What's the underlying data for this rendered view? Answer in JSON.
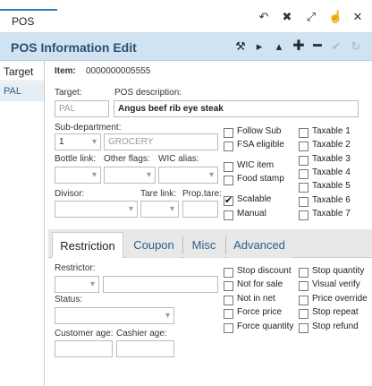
{
  "window": {
    "tab_label": "POS",
    "icons": [
      "undo-icon",
      "shrink-icon",
      "expand-icon",
      "pointer-icon",
      "close-icon"
    ]
  },
  "header": {
    "title": "POS Information Edit",
    "icons": [
      "pin-icon",
      "next-icon",
      "collapse-icon",
      "add-icon",
      "remove-icon",
      "save-icon",
      "revert-icon"
    ]
  },
  "leftnav": {
    "items": [
      {
        "label": "Target"
      },
      {
        "label": "PAL"
      }
    ]
  },
  "item": {
    "label": "Item:",
    "value": "0000000005555"
  },
  "target": {
    "label": "Target:",
    "value": "PAL"
  },
  "pos_description": {
    "label": "POS description:",
    "value": "Angus beef rib eye steak"
  },
  "subdept": {
    "label": "Sub-department:",
    "value": "1",
    "name": "GROCERY"
  },
  "bottle_link": {
    "label": "Bottle link:",
    "value": ""
  },
  "other_flags": {
    "label": "Other flags:",
    "value": ""
  },
  "wic_alias": {
    "label": "WIC alias:",
    "value": ""
  },
  "divisor": {
    "label": "Divisor:",
    "value": ""
  },
  "tare_link": {
    "label": "Tare link:",
    "value": ""
  },
  "prop_tare": {
    "label": "Prop.tare:",
    "value": ""
  },
  "flags_col1": [
    {
      "label": "Follow Sub",
      "checked": false
    },
    {
      "label": "FSA eligible",
      "checked": false
    },
    {
      "label": "WIC item",
      "checked": false
    },
    {
      "label": "Food stamp",
      "checked": false
    },
    {
      "label": "Scalable",
      "checked": true
    },
    {
      "label": "Manual",
      "checked": false
    }
  ],
  "taxables": [
    {
      "label": "Taxable 1",
      "checked": false
    },
    {
      "label": "Taxable 2",
      "checked": false
    },
    {
      "label": "Taxable 3",
      "checked": false
    },
    {
      "label": "Taxable 4",
      "checked": false
    },
    {
      "label": "Taxable 5",
      "checked": false
    },
    {
      "label": "Taxable 6",
      "checked": false
    },
    {
      "label": "Taxable 7",
      "checked": false
    }
  ],
  "tabs": [
    {
      "label": "Restriction",
      "active": true
    },
    {
      "label": "Coupon",
      "active": false
    },
    {
      "label": "Misc",
      "active": false
    },
    {
      "label": "Advanced",
      "active": false
    }
  ],
  "restriction": {
    "restrictor_label": "Restrictor:",
    "status_label": "Status:",
    "customer_age_label": "Customer age:",
    "cashier_age_label": "Cashier age:",
    "checks_col1": [
      {
        "label": "Stop discount",
        "checked": false
      },
      {
        "label": "Not for sale",
        "checked": false
      },
      {
        "label": "Not in net",
        "checked": false
      },
      {
        "label": "Force price",
        "checked": false
      },
      {
        "label": "Force quantity",
        "checked": false
      }
    ],
    "checks_col2": [
      {
        "label": "Stop quantity",
        "checked": false
      },
      {
        "label": "Visual verify",
        "checked": false
      },
      {
        "label": "Price override",
        "checked": false
      },
      {
        "label": "Stop repeat",
        "checked": false
      },
      {
        "label": "Stop refund",
        "checked": false
      }
    ]
  }
}
